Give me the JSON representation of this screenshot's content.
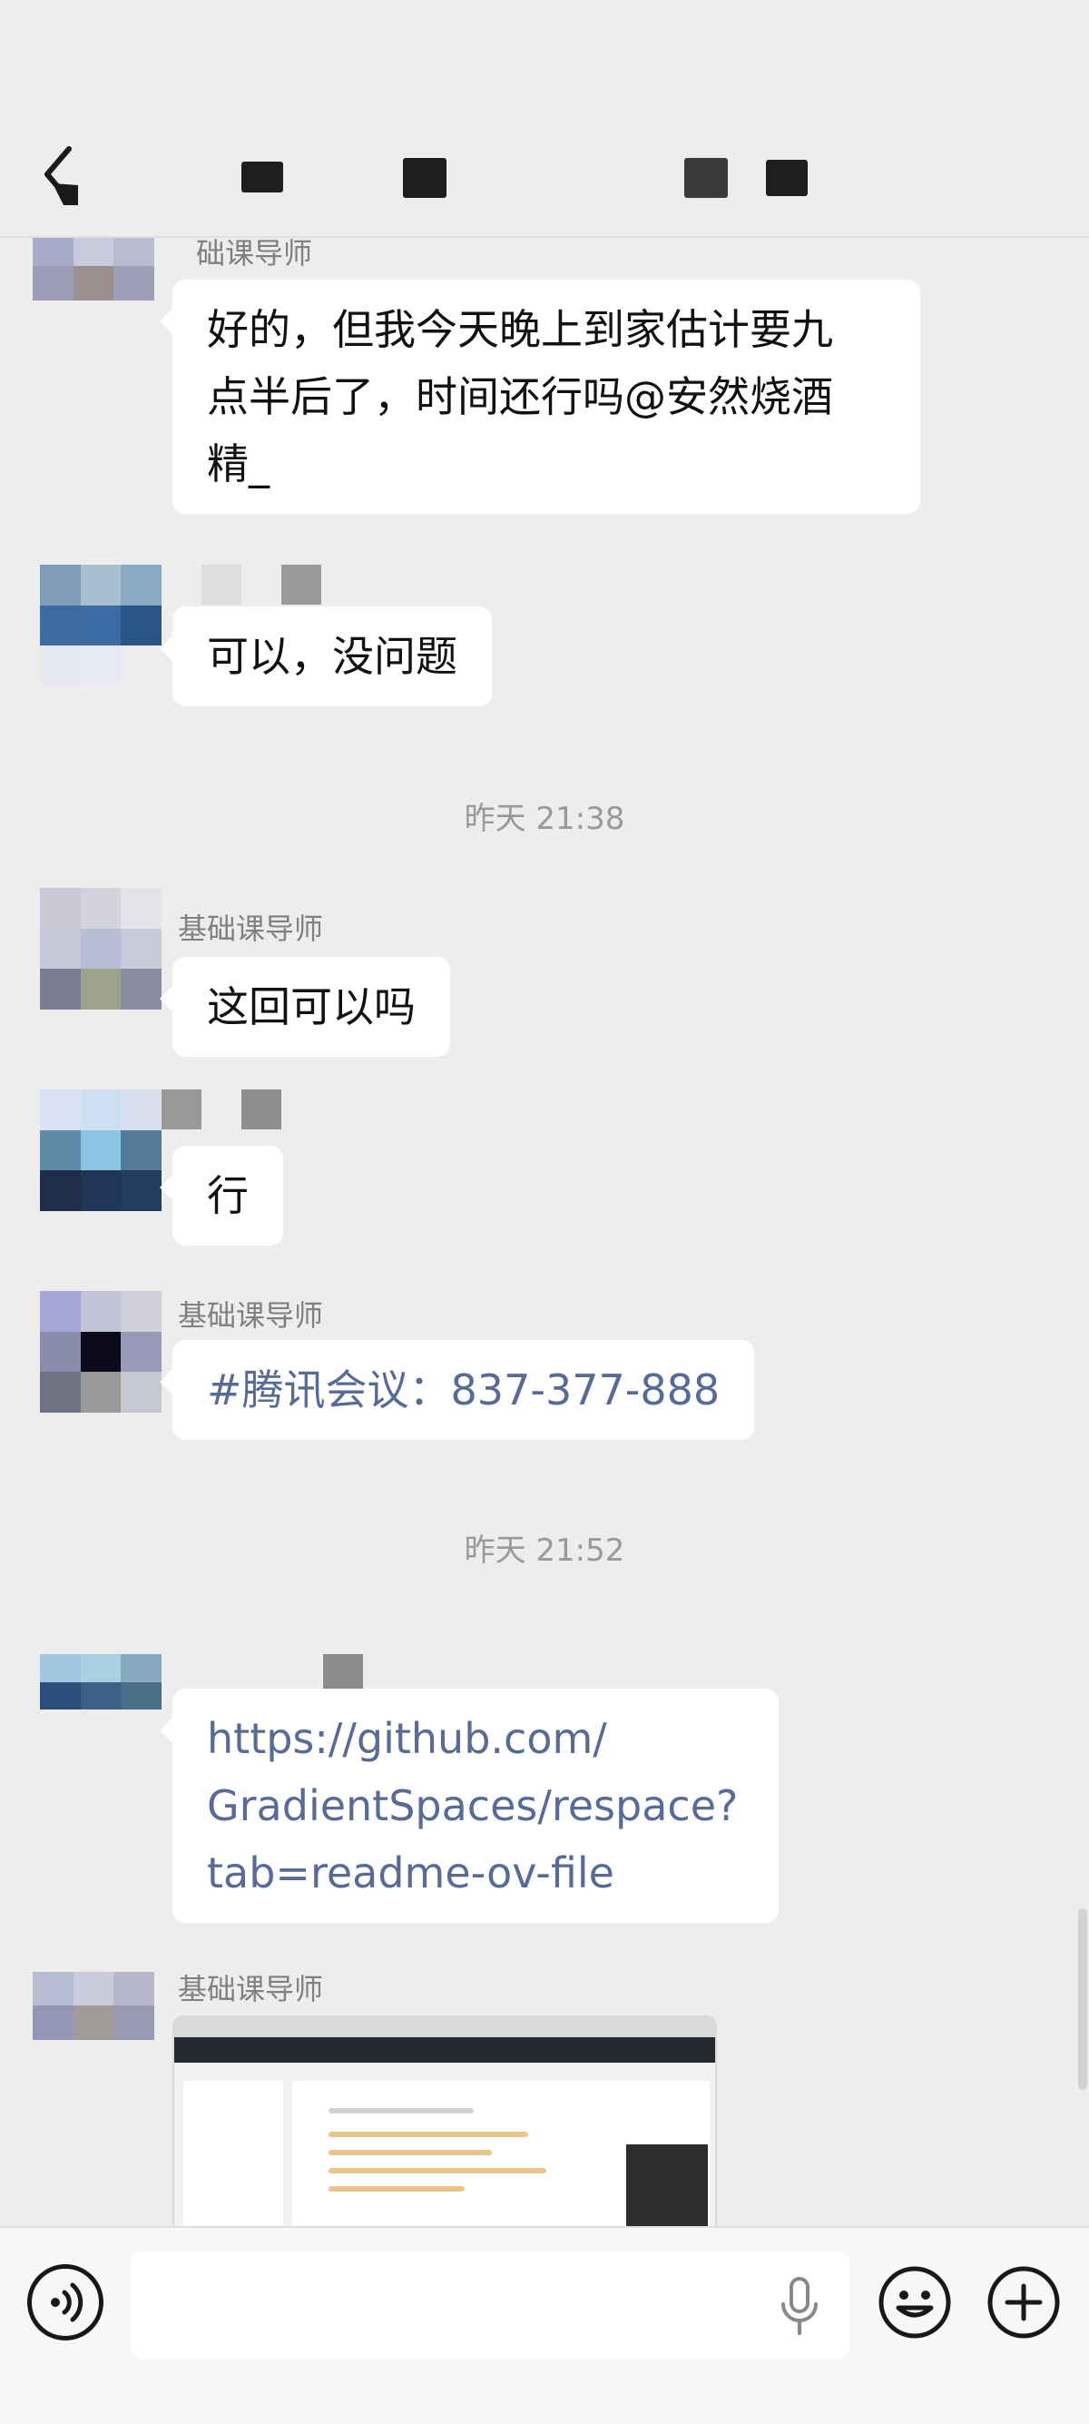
{
  "header": {
    "back_icon": "chevron-left-icon"
  },
  "messages": [
    {
      "sender": "础课导师",
      "lines": [
        "好的，但我今天晚上到家估计要九",
        "点半后了，时间还行吗@安然烧酒",
        "精_"
      ]
    },
    {
      "sender": "",
      "text": "可以，没问题"
    },
    {
      "sender": "基础课导师",
      "text": "这回可以吗"
    },
    {
      "sender": "",
      "text": "行"
    },
    {
      "sender": "基础课导师",
      "text": "#腾讯会议：837-377-888"
    },
    {
      "sender": "",
      "lines": [
        "https://github.com/",
        "GradientSpaces/respace?",
        "tab=readme-ov-file"
      ]
    },
    {
      "sender": "基础课导师",
      "image": "screenshot-thumbnail"
    }
  ],
  "timestamps": [
    "昨天 21:38",
    "昨天 21:52"
  ],
  "input_bar": {
    "placeholder": "",
    "voice_icon": "voice-icon",
    "mic_icon": "mic-icon",
    "emoji_icon": "emoji-icon",
    "plus_icon": "plus-icon"
  }
}
